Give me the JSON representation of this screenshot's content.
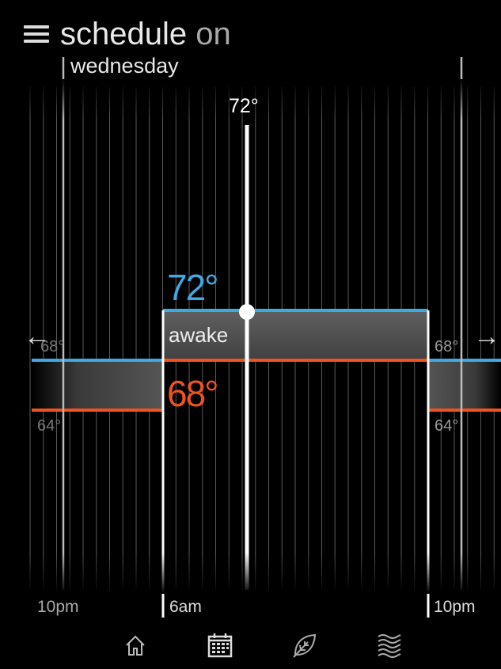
{
  "header": {
    "title": "schedule",
    "status": "on"
  },
  "day": "wednesday",
  "current_setpoint": "72°",
  "period": {
    "name": "awake",
    "heat_to": "72°",
    "cool_to": "68°"
  },
  "side_limits": {
    "high": "68°",
    "low": "64°"
  },
  "times": {
    "start_prev": "10pm",
    "wake": "6am",
    "end": "10pm"
  },
  "colors": {
    "upper_line": "#3fa9e0",
    "lower_line": "#f0531e",
    "band": "#4a4a4a"
  },
  "nav": [
    "home-icon",
    "calendar-icon",
    "leaf-icon",
    "waves-icon"
  ]
}
